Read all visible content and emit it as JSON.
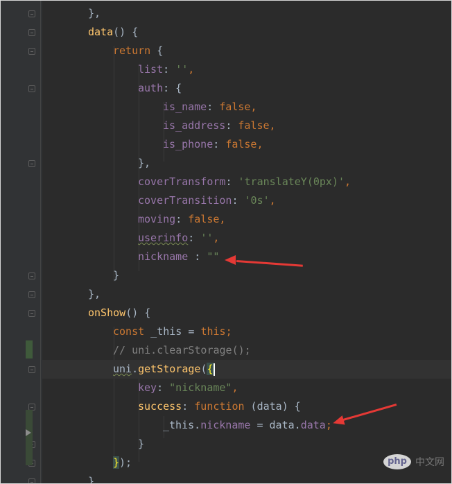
{
  "colors": {
    "background": "#2b2b2b",
    "keyword": "#cc7832",
    "function": "#ffc66d",
    "property": "#9876aa",
    "string": "#6a8759",
    "text": "#a9b7c6",
    "comment": "#808080",
    "annotation_arrow": "#e53935"
  },
  "code": {
    "l01": {
      "t1": "},"
    },
    "l02": {
      "fn": "data",
      "rest": "() {"
    },
    "l03": {
      "kw": "return",
      "rest": " {"
    },
    "l04": {
      "prop": "list",
      "colon": ": ",
      "str": "''",
      "comma": ","
    },
    "l05": {
      "prop": "auth",
      "rest": ": {"
    },
    "l06": {
      "prop": "is_name",
      "colon": ": ",
      "kw": "false",
      "comma": ","
    },
    "l07": {
      "prop": "is_address",
      "colon": ": ",
      "kw": "false",
      "comma": ","
    },
    "l08": {
      "prop": "is_phone",
      "colon": ": ",
      "kw": "false",
      "comma": ","
    },
    "l09": {
      "t1": "},"
    },
    "l10": {
      "prop": "coverTransform",
      "colon": ": ",
      "str": "'translateY(0px)'",
      "comma": ","
    },
    "l11": {
      "prop": "coverTransition",
      "colon": ": ",
      "str": "'0s'",
      "comma": ","
    },
    "l12": {
      "prop": "moving",
      "colon": ": ",
      "kw": "false",
      "comma": ","
    },
    "l13": {
      "prop": "userinfo",
      "colon": ": ",
      "str": "''",
      "comma": ","
    },
    "l14": {
      "prop": "nickname",
      "colon": " : ",
      "str": "\"\""
    },
    "l15": {
      "t1": "}"
    },
    "l16": {
      "t1": "},"
    },
    "l17": {
      "fn": "onShow",
      "rest": "() {"
    },
    "l18": {
      "kw1": "const",
      "mid": " _this = ",
      "kw2": "this",
      "end": ";"
    },
    "l19": {
      "cmt": "// uni.clearStorage();"
    },
    "l20": {
      "obj": "uni",
      "dot": ".",
      "fn": "getStorage",
      "open": "(",
      "brace": "{"
    },
    "l21": {
      "prop": "key",
      "colon": ": ",
      "str": "\"nickname\"",
      "comma": ","
    },
    "l22": {
      "fn": "success",
      "colon": ": ",
      "kw": "function",
      "rest": " (data) {"
    },
    "l23": {
      "a": "_this.",
      "prop": "nickname",
      "b": " = data.",
      "prop2": "data",
      "semi": ";"
    },
    "l24": {
      "t1": "}"
    },
    "l25": {
      "brace": "}",
      "rest": ");"
    },
    "l26": {
      "t1": "}"
    }
  },
  "watermark": {
    "logo": "php",
    "text": "中文网"
  }
}
